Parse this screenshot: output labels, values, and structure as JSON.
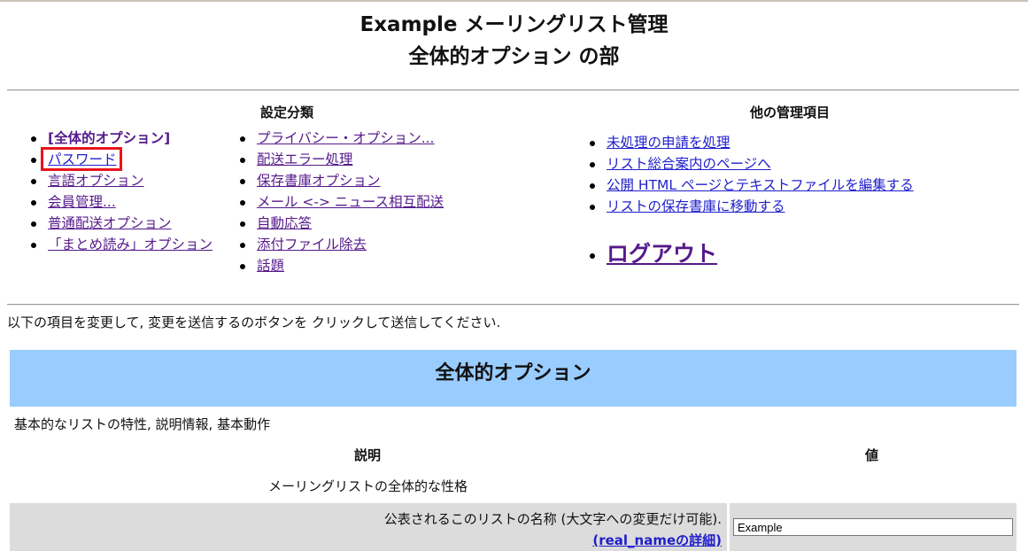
{
  "header": {
    "title_line1": "Example メーリングリスト管理",
    "title_line2": "全体的オプション の部"
  },
  "categories": {
    "heading": "設定分類",
    "col1": [
      {
        "label": "[全体的オプション]",
        "current": true
      },
      {
        "label": "パスワード",
        "highlighted": true
      },
      {
        "label": "言語オプション"
      },
      {
        "label": "会員管理..."
      },
      {
        "label": "普通配送オプション"
      },
      {
        "label": "「まとめ読み」オプション"
      }
    ],
    "col2": [
      {
        "label": "プライバシー・オプション..."
      },
      {
        "label": "配送エラー処理"
      },
      {
        "label": "保存書庫オプション"
      },
      {
        "label": "メール <-> ニュース相互配送"
      },
      {
        "label": "自動応答"
      },
      {
        "label": "添付ファイル除去"
      },
      {
        "label": "話題"
      }
    ]
  },
  "other_admin": {
    "heading": "他の管理項目",
    "items": [
      {
        "label": "未処理の申請を処理"
      },
      {
        "label": "リスト総合案内のページへ"
      },
      {
        "label": "公開 HTML ページとテキストファイルを編集する"
      },
      {
        "label": "リストの保存書庫に移動する"
      }
    ],
    "logout": "ログアウト"
  },
  "instructions": "以下の項目を変更して, 変更を送信するのボタンを クリックして送信してください.",
  "section": {
    "title": "全体的オプション",
    "description": "基本的なリストの特性, 説明情報, 基本動作",
    "col_description": "説明",
    "col_value": "値",
    "subheading": "メーリングリストの全体的な性格",
    "rows": [
      {
        "label": "公表されるこのリストの名称 (大文字への変更だけ可能).",
        "details_link": "(real_nameの詳細)",
        "value": "Example"
      }
    ]
  },
  "colors": {
    "band": "#99ccff",
    "row_bg": "#dcdcdc",
    "highlight_box": "#e8141b",
    "link_visited": "#551a8b",
    "link": "#1f1fcc"
  }
}
